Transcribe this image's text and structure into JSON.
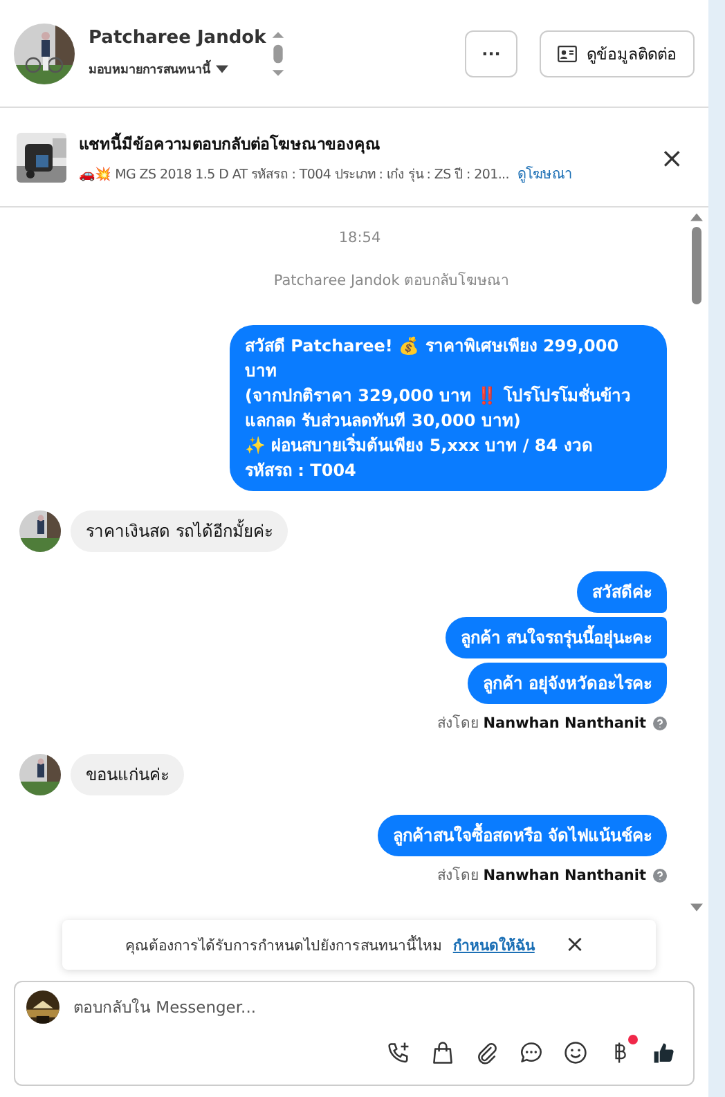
{
  "header": {
    "name": "Patcharee Jandok",
    "assign": "มอบหมายการสนทนานี้",
    "more_button": "···",
    "contact_button": "ดูข้อมูลติดต่อ"
  },
  "ad_bar": {
    "title": "แชทนี้มีข้อความตอบกลับต่อโฆษณาของคุณ",
    "details": "🚗💥 MG ZS 2018 1.5 D AT รหัสรถ : T004 ประเภท : เก๋ง รุ่น : ZS ปี : 201...",
    "link": "ดูโฆษณา",
    "close": "×"
  },
  "messages": [
    {
      "kind": "time",
      "text": "18:54"
    },
    {
      "kind": "note",
      "text": "Patcharee Jandok ตอบกลับโฆษณา"
    },
    {
      "kind": "outgoing",
      "text": "สวัสดี Patcharee! 💰 ราคาพิเศษเพียง 299,000 บาท\n(จากปกติราคา 329,000 บาท ‼️ โปรโปรโมชั่นข้าวแลกลด รับส่วนลดทันที 30,000 บาท)\n✨ ผ่อนสบายเริ่มต้นเพียง 5,xxx บาท / 84 งวด\nรหัสรถ : T004"
    },
    {
      "kind": "incoming",
      "text": "ราคาเงินสด รถได้อีกมั้ยค่ะ"
    },
    {
      "kind": "outgoing",
      "text": "สวัสดีค่ะ"
    },
    {
      "kind": "outgoing",
      "text": "ลูกค้า สนใจรถรุ่นนี้อยุ่นะคะ"
    },
    {
      "kind": "outgoing",
      "text": "ลูกค้า อยุ่จังหวัดอะไรคะ"
    },
    {
      "kind": "sent_by",
      "text": "ส่งโดย **Nanwhan Nanthanit**"
    },
    {
      "kind": "incoming",
      "text": "ขอนแก่นค่ะ"
    },
    {
      "kind": "outgoing",
      "text": "ลูกค้าสนใจซื้อสดหรือ จัดไฟแน้นช์คะ"
    },
    {
      "kind": "sent_by",
      "text": "ส่งโดย **Nanwhan Nanthanit**"
    }
  ],
  "banner": {
    "text": "คุณต้องการได้รับการกำหนดไปยังการสนทนานี้ไหม",
    "link": "กำหนดให้ฉัน",
    "close": "×"
  },
  "composer": {
    "placeholder": "ตอบกลับใน Messenger...",
    "baht_badge": true
  }
}
